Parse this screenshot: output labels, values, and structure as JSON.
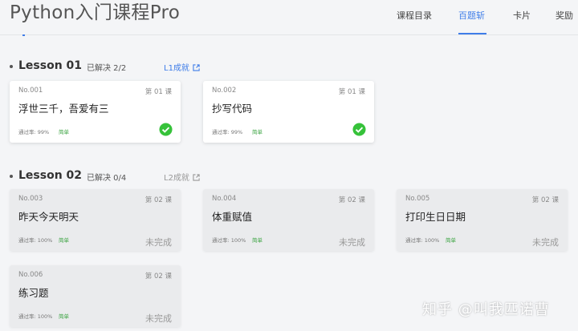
{
  "app": {
    "title": "Python入门课程Pro"
  },
  "nav": [
    {
      "label": "课程目录"
    },
    {
      "label": "百题斩"
    },
    {
      "label": "卡片"
    },
    {
      "label": "奖励"
    }
  ],
  "colors": {
    "accent": "#3f7de8",
    "success": "#36c23a",
    "easy": "#3aa340"
  },
  "lessons": [
    {
      "title": "Lesson 01",
      "solved": "已解决 2/2",
      "achievement": "L1成就",
      "cards": [
        {
          "no": "No.001",
          "lesson": "第 01 课",
          "title": "浮世三千，吾爱有三",
          "pass_rate": "通过率: 99%",
          "difficulty": "简单",
          "status_icon": "check-icon"
        },
        {
          "no": "No.002",
          "lesson": "第 01 课",
          "title": "抄写代码",
          "pass_rate": "通过率: 99%",
          "difficulty": "简单",
          "status_icon": "check-icon"
        }
      ]
    },
    {
      "title": "Lesson 02",
      "solved": "已解决 0/4",
      "achievement": "L2成就",
      "cards": [
        {
          "no": "No.003",
          "lesson": "第 02 课",
          "title": "昨天今天明天",
          "pass_rate": "通过率: 100%",
          "difficulty": "简单",
          "status": "未完成"
        },
        {
          "no": "No.004",
          "lesson": "第 02 课",
          "title": "体重赋值",
          "pass_rate": "通过率: 100%",
          "difficulty": "简单",
          "status": "未完成"
        },
        {
          "no": "No.005",
          "lesson": "第 02 课",
          "title": "打印生日日期",
          "pass_rate": "通过率: 100%",
          "difficulty": "简单",
          "status": "未完成"
        },
        {
          "no": "No.006",
          "lesson": "第 02 课",
          "title": "练习题",
          "pass_rate": "通过率: 100%",
          "difficulty": "简单",
          "status": "未完成"
        }
      ]
    }
  ],
  "watermark": "知乎 @叫我匹诺曹"
}
